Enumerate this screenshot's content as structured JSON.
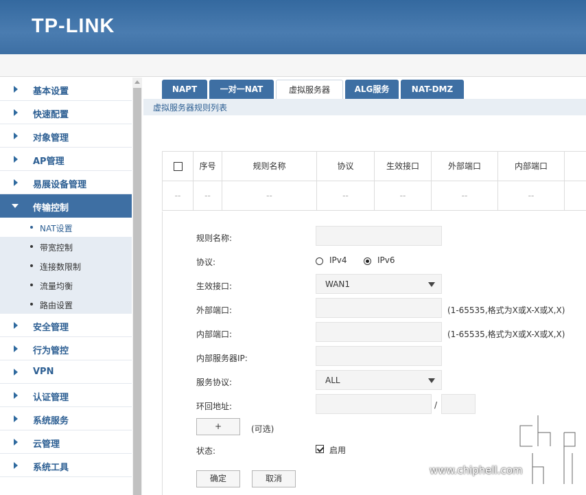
{
  "brand": "TP-LINK",
  "sidebar": {
    "items": [
      {
        "label": "基本设置"
      },
      {
        "label": "快速配置"
      },
      {
        "label": "对象管理"
      },
      {
        "label": "AP管理"
      },
      {
        "label": "易展设备管理"
      },
      {
        "label": "传输控制",
        "active": true
      },
      {
        "label": "安全管理"
      },
      {
        "label": "行为管控"
      },
      {
        "label": "VPN"
      },
      {
        "label": "认证管理"
      },
      {
        "label": "系统服务"
      },
      {
        "label": "云管理"
      },
      {
        "label": "系统工具"
      }
    ],
    "subitems": [
      {
        "label": "NAT设置",
        "active": true
      },
      {
        "label": "带宽控制"
      },
      {
        "label": "连接数限制"
      },
      {
        "label": "流量均衡"
      },
      {
        "label": "路由设置"
      }
    ]
  },
  "tabs": [
    "NAPT",
    "一对一NAT",
    "虚拟服务器",
    "ALG服务",
    "NAT-DMZ"
  ],
  "active_tab": "虚拟服务器",
  "section_title": "虚拟服务器规则列表",
  "table": {
    "headers": [
      "序号",
      "规则名称",
      "协议",
      "生效接口",
      "外部端口",
      "内部端口"
    ],
    "empty_cell": "--"
  },
  "form": {
    "rule_name_label": "规则名称:",
    "protocol_label": "协议:",
    "ipv4_label": "IPv4",
    "ipv6_label": "IPv6",
    "protocol_selected": "IPv6",
    "interface_label": "生效接口:",
    "interface_value": "WAN1",
    "ext_port_label": "外部端口:",
    "ext_port_hint": "(1-65535,格式为X或X-X或X,X)",
    "int_port_label": "内部端口:",
    "int_port_hint": "(1-65535,格式为X或X-X或X,X)",
    "server_ip_label": "内部服务器IP:",
    "service_protocol_label": "服务协议:",
    "service_protocol_value": "ALL",
    "loopback_label": "环回地址:",
    "loopback_sep": "/",
    "add_button": "+",
    "optional_text": "(可选)",
    "status_label": "状态:",
    "enable_label": "启用",
    "enabled": true,
    "ok_button": "确定",
    "cancel_button": "取消"
  },
  "watermark": {
    "url": "www.chiphell.com",
    "logo_word": "chip hell"
  },
  "colors": {
    "header_blue": "#3e6fa3",
    "menu_text": "#2d5f93"
  }
}
